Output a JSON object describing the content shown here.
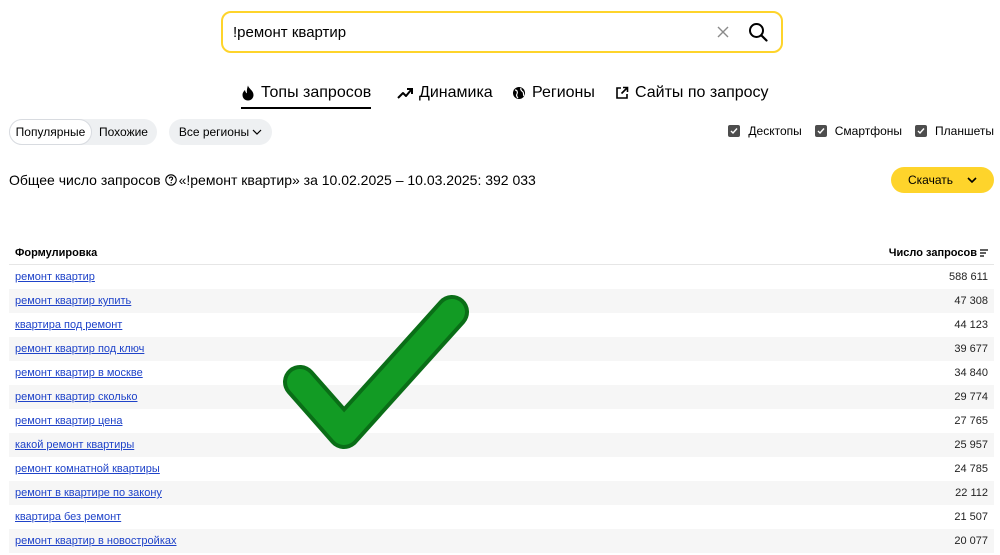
{
  "search": {
    "value": "!ремонт квартир"
  },
  "tabs": [
    {
      "label": "Топы запросов",
      "icon": "fire-icon"
    },
    {
      "label": "Динамика",
      "icon": "trend-icon"
    },
    {
      "label": "Регионы",
      "icon": "globe-icon"
    },
    {
      "label": "Сайты по запросу",
      "icon": "external-link-icon"
    }
  ],
  "filters": {
    "popular": "Популярные",
    "similar": "Похожие",
    "regions": "Все регионы",
    "devices": [
      "Десктопы",
      "Смартфоны",
      "Планшеты"
    ]
  },
  "summary": {
    "label": "Общее число запросов",
    "detail": "«!ремонт квартир» за 10.02.2025 – 10.03.2025: 392 033"
  },
  "download_label": "Скачать",
  "table": {
    "col_phrase": "Формулировка",
    "col_count": "Число запросов",
    "rows": [
      {
        "phrase": "ремонт квартир",
        "count": "588 611"
      },
      {
        "phrase": "ремонт квартир купить",
        "count": "47 308"
      },
      {
        "phrase": "квартира под ремонт",
        "count": "44 123"
      },
      {
        "phrase": "ремонт квартир под ключ",
        "count": "39 677"
      },
      {
        "phrase": "ремонт квартир в москве",
        "count": "34 840"
      },
      {
        "phrase": "ремонт квартир сколько",
        "count": "29 774"
      },
      {
        "phrase": "ремонт квартир цена",
        "count": "27 765"
      },
      {
        "phrase": "какой ремонт квартиры",
        "count": "25 957"
      },
      {
        "phrase": "ремонт комнатной квартиры",
        "count": "24 785"
      },
      {
        "phrase": "ремонт в квартире по закону",
        "count": "22 112"
      },
      {
        "phrase": "квартира без ремонт",
        "count": "21 507"
      },
      {
        "phrase": "ремонт квартир в новостройках",
        "count": "20 077"
      }
    ]
  },
  "colors": {
    "accent": "#fed42b",
    "link": "#1f43c9",
    "checkmark": "#0f8a1e"
  }
}
